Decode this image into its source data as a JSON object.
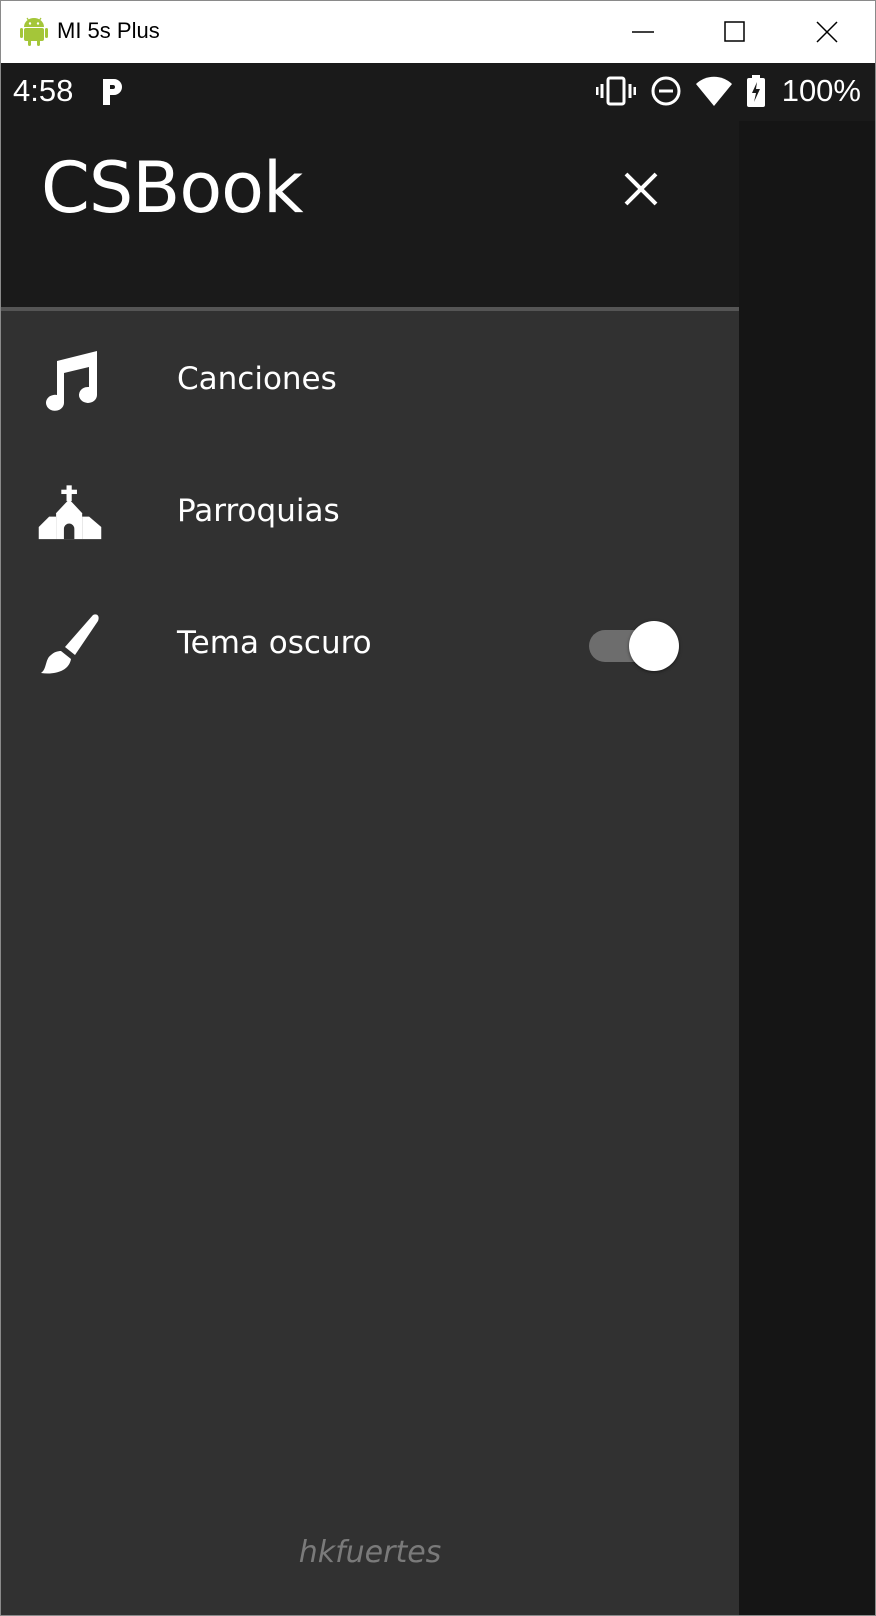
{
  "window": {
    "title": "MI 5s Plus",
    "icons": {
      "app": "android-icon",
      "minimize": "minimize-icon",
      "maximize": "maximize-icon",
      "close": "close-icon"
    }
  },
  "statusbar": {
    "time": "4:58",
    "notification_icon": "parking-p-icon",
    "icons": [
      "vibrate-icon",
      "do-not-disturb-icon",
      "wifi-icon",
      "battery-charging-icon"
    ],
    "battery": "100%"
  },
  "drawer": {
    "title": "CSBook",
    "close_icon": "close-icon",
    "items": [
      {
        "label": "Canciones",
        "icon": "music-note-icon"
      },
      {
        "label": "Parroquias",
        "icon": "church-icon"
      },
      {
        "label": "Tema oscuro",
        "icon": "paintbrush-icon",
        "toggle_on": true
      }
    ],
    "footer": "hkfuertes"
  },
  "colors": {
    "drawer_bg": "#313131",
    "header_bg": "#1a1a1a",
    "text": "#ffffff",
    "footer_text": "#7a7a7a",
    "android_green": "#a4c639"
  }
}
